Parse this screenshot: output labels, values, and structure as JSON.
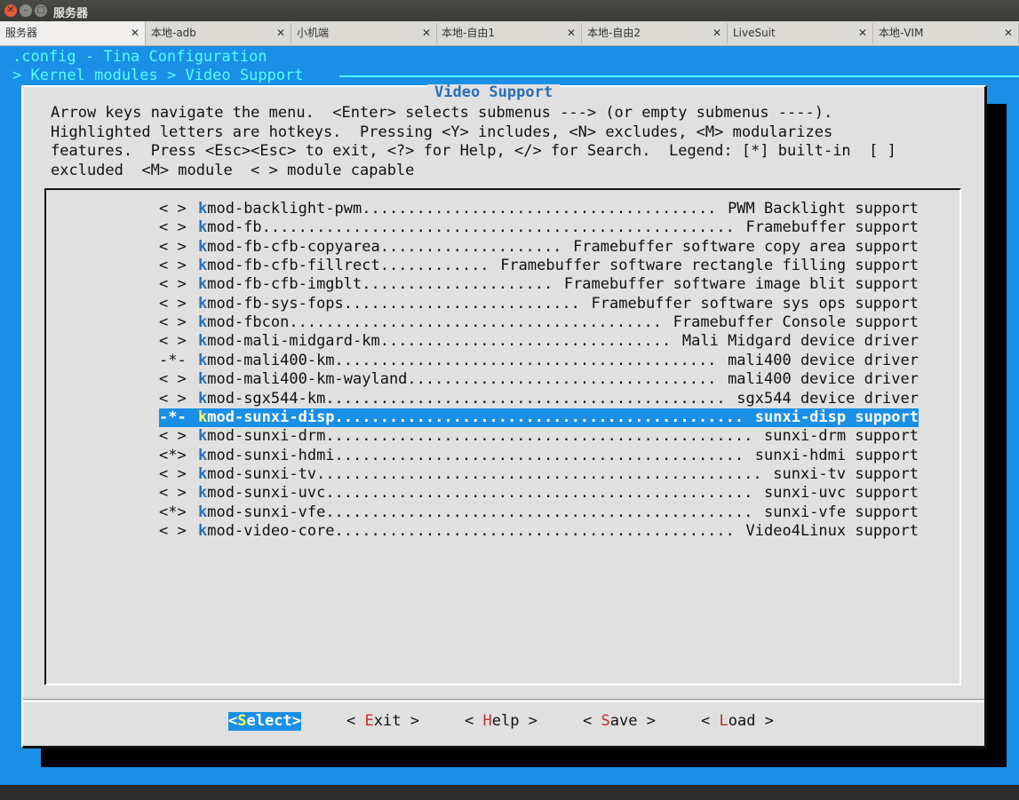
{
  "window": {
    "title": "服务器"
  },
  "tabs": [
    {
      "label": "服务器",
      "active": true
    },
    {
      "label": "本地-adb"
    },
    {
      "label": "小机端"
    },
    {
      "label": "本地-自由1"
    },
    {
      "label": "本地-自由2"
    },
    {
      "label": "LiveSuit"
    },
    {
      "label": "本地-VIM"
    }
  ],
  "tab_close_glyph": "✕",
  "terminal": {
    "header_line1": ".config - Tina Configuration",
    "header_line2": "> Kernel modules > Video Support",
    "dialog_title": "Video Support",
    "help_lines": [
      "Arrow keys navigate the menu.  <Enter> selects submenus ---> (or empty submenus ----).",
      "Highlighted letters are hotkeys.  Pressing <Y> includes, <N> excludes, <M> modularizes",
      "features.  Press <Esc><Esc> to exit, <?> for Help, </> for Search.  Legend: [*] built-in  [ ]",
      "excluded  <M> module  < > module capable"
    ],
    "items": [
      {
        "status": "< >",
        "hotkey": "k",
        "name": "mod-backlight-pwm",
        "desc": "PWM Backlight support"
      },
      {
        "status": "< >",
        "hotkey": "k",
        "name": "mod-fb",
        "desc": "Framebuffer support"
      },
      {
        "status": "< >",
        "hotkey": "k",
        "name": "mod-fb-cfb-copyarea",
        "desc": "Framebuffer software copy area support"
      },
      {
        "status": "< >",
        "hotkey": "k",
        "name": "mod-fb-cfb-fillrect",
        "desc": "Framebuffer software rectangle filling support"
      },
      {
        "status": "< >",
        "hotkey": "k",
        "name": "mod-fb-cfb-imgblt",
        "desc": "Framebuffer software image blit support"
      },
      {
        "status": "< >",
        "hotkey": "k",
        "name": "mod-fb-sys-fops",
        "desc": "Framebuffer software sys ops support"
      },
      {
        "status": "< >",
        "hotkey": "k",
        "name": "mod-fbcon",
        "desc": "Framebuffer Console support"
      },
      {
        "status": "< >",
        "hotkey": "k",
        "name": "mod-mali-midgard-km",
        "desc": "Mali Midgard device driver"
      },
      {
        "status": "-*-",
        "hotkey": "k",
        "name": "mod-mali400-km",
        "desc": "mali400 device driver"
      },
      {
        "status": "< >",
        "hotkey": "k",
        "name": "mod-mali400-km-wayland",
        "desc": "mali400 device driver"
      },
      {
        "status": "< >",
        "hotkey": "k",
        "name": "mod-sgx544-km",
        "desc": "sgx544 device driver"
      },
      {
        "status": "-*-",
        "hotkey": "k",
        "name": "mod-sunxi-disp",
        "desc": "sunxi-disp support",
        "selected": true
      },
      {
        "status": "< >",
        "hotkey": "k",
        "name": "mod-sunxi-drm",
        "desc": "sunxi-drm support"
      },
      {
        "status": "<*>",
        "hotkey": "k",
        "name": "mod-sunxi-hdmi",
        "desc": "sunxi-hdmi support"
      },
      {
        "status": "< >",
        "hotkey": "k",
        "name": "mod-sunxi-tv",
        "desc": "sunxi-tv support"
      },
      {
        "status": "< >",
        "hotkey": "k",
        "name": "mod-sunxi-uvc",
        "desc": "sunxi-uvc support"
      },
      {
        "status": "<*>",
        "hotkey": "k",
        "name": "mod-sunxi-vfe",
        "desc": "sunxi-vfe support"
      },
      {
        "status": "< >",
        "hotkey": "k",
        "name": "mod-video-core",
        "desc": "Video4Linux support"
      }
    ],
    "buttons": [
      {
        "pre": "<",
        "hotkey": "S",
        "rest": "elect",
        "post": ">",
        "active": true
      },
      {
        "pre": "< ",
        "hotkey": "E",
        "rest": "xit",
        "post": " >"
      },
      {
        "pre": "< ",
        "hotkey": "H",
        "rest": "elp",
        "post": " >"
      },
      {
        "pre": "< ",
        "hotkey": "S",
        "rest": "ave",
        "post": " >"
      },
      {
        "pre": "< ",
        "hotkey": "L",
        "rest": "oad",
        "post": " >"
      }
    ]
  }
}
